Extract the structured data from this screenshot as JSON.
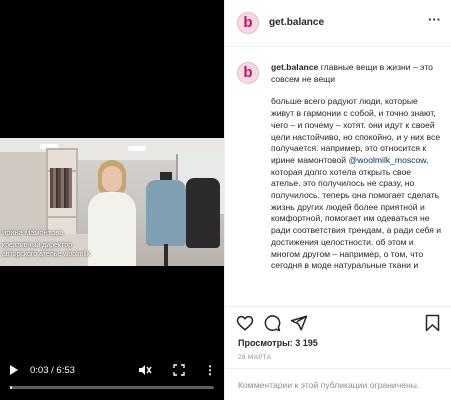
{
  "video": {
    "caption_name": "ирина мамонтова",
    "caption_role": "креативный директор авторского ателье woolmilk",
    "current_time": "0:03",
    "duration": "6:53",
    "time_label": "0:03 / 6:53",
    "progress_fraction": 0.007
  },
  "post": {
    "username": "get.balance",
    "avatar_letter": "b",
    "caption_first": "главные вещи в жизни – это совсем не вещи",
    "caption_para_before_mention": "больше всего радуют люди, которые живут в гармонии с собой, и точно знают, чего – и почему – хотят. они идут к своей цели настойчиво, но спокойно, и у них все получается. например, это относится к ирине мамонтовой ",
    "mention": "@woolmilk_moscow",
    "caption_para_after_mention": ", которая долго хотела открыть свое ателье. это получилось не сразу, но получилось. теперь она помогает сделать жизнь других людей более приятной и комфортной, помогает им одеваться не ради соответствия трендам, а ради себя и достижения целостности. об этом и многом другом – например, о том, что сегодня в моде натуральные ткани и",
    "views": "Просмотры: 3 195",
    "date": "28 МАРТА",
    "comments_off": "Комментарии к этой публикации ограничены."
  },
  "icons": {
    "like": "heart-icon",
    "comment": "comment-icon",
    "share": "share-icon",
    "save": "bookmark-icon",
    "more": "more-icon"
  },
  "colors": {
    "avatar_brand": "#c2185b",
    "mention": "#00376b",
    "muted": "#8e8e8e"
  }
}
